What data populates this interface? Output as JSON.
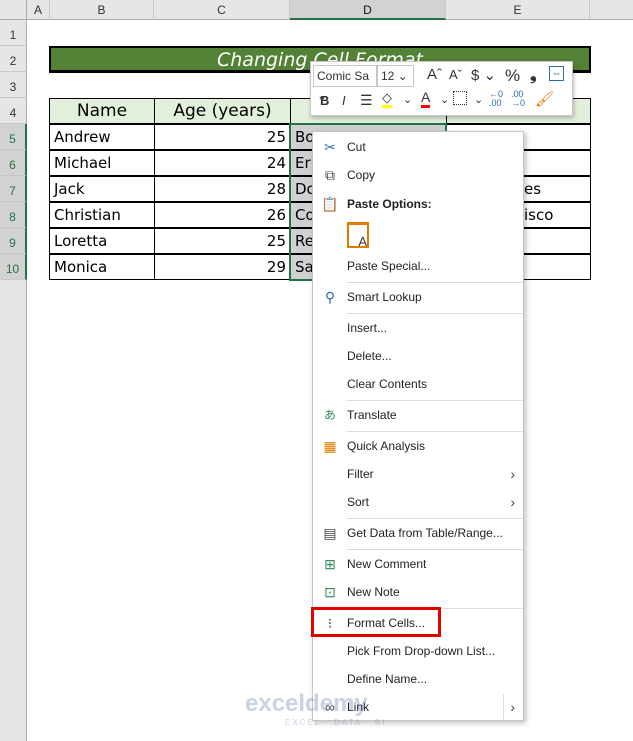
{
  "columns": [
    "A",
    "B",
    "C",
    "D",
    "E"
  ],
  "rows": [
    "1",
    "2",
    "3",
    "4",
    "5",
    "6",
    "7",
    "8",
    "9",
    "10"
  ],
  "sheet": {
    "title": "Changing Cell Format",
    "headers": [
      "Name",
      "Age (years)"
    ],
    "records": [
      {
        "name": "Andrew",
        "age": "25",
        "occ": "Bo",
        "birth": ""
      },
      {
        "name": "Michael",
        "age": "24",
        "occ": "Er",
        "birth": ""
      },
      {
        "name": "Jack",
        "age": "28",
        "occ": "Do",
        "birth": "es"
      },
      {
        "name": "Christian",
        "age": "26",
        "occ": "Co",
        "birth": "isco"
      },
      {
        "name": "Loretta",
        "age": "25",
        "occ": "Re",
        "birth": ""
      },
      {
        "name": "Monica",
        "age": "29",
        "occ": "Sa",
        "birth": ""
      }
    ]
  },
  "mini_toolbar": {
    "font": "Comic Sa",
    "size": "12",
    "fill_color": "#ffff00",
    "font_color": "#ff0000"
  },
  "context_menu": {
    "items": [
      "Cut",
      "Copy",
      "Paste Options:",
      "Paste Special...",
      "Smart Lookup",
      "Insert...",
      "Delete...",
      "Clear Contents",
      "Translate",
      "Quick Analysis",
      "Filter",
      "Sort",
      "Get Data from Table/Range...",
      "New Comment",
      "New Note",
      "Format Cells...",
      "Pick From Drop-down List...",
      "Define Name...",
      "Link"
    ],
    "highlighted": "Format Cells...",
    "highlight_color": "#e50000"
  },
  "watermark": {
    "name": "exceldemy",
    "tagline": "EXCEL · DATA · BI"
  }
}
